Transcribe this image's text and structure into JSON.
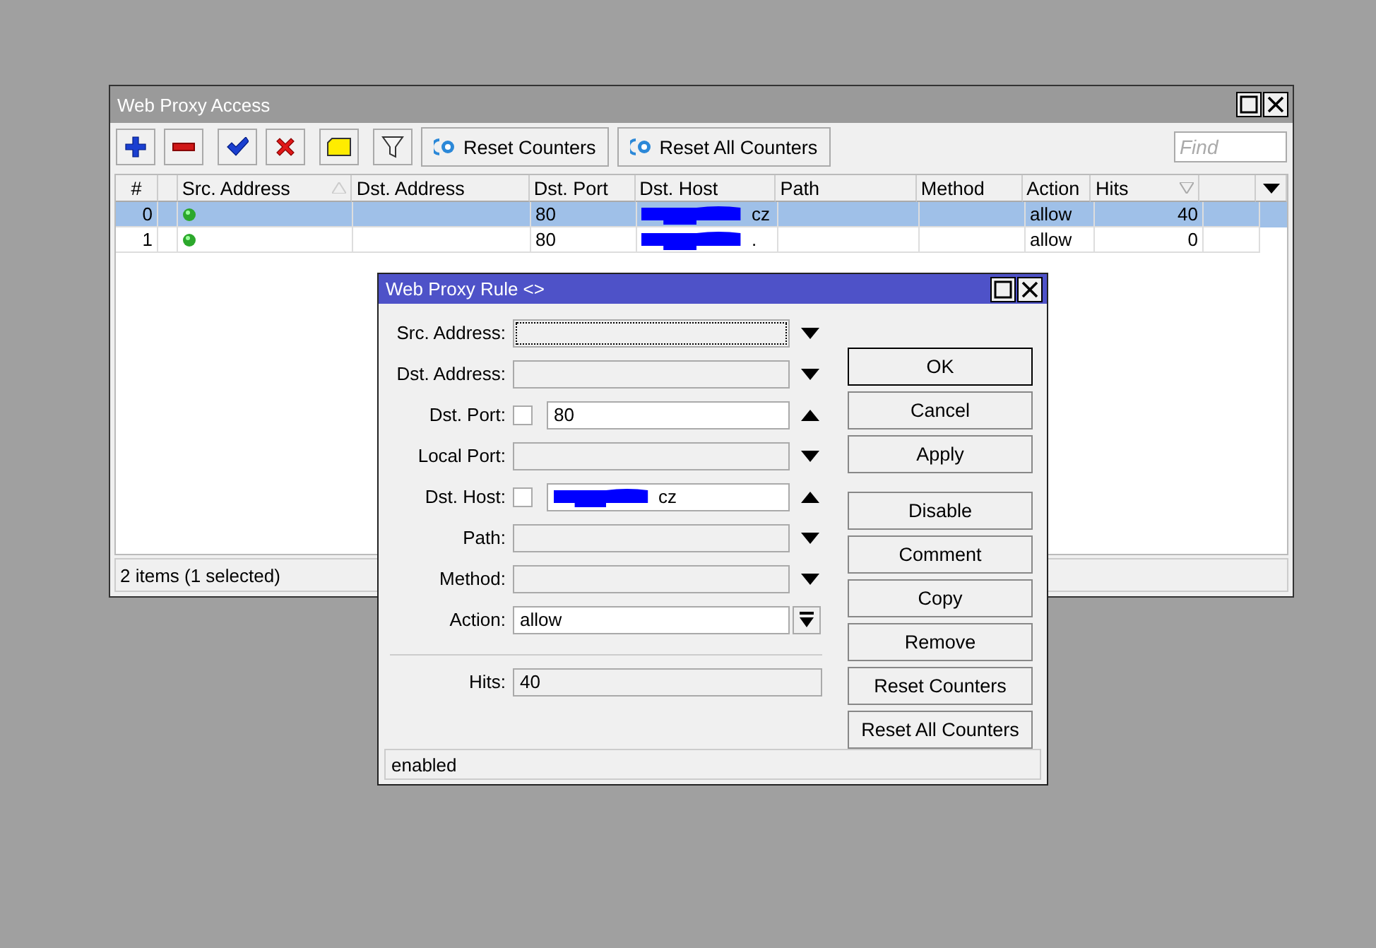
{
  "main_window": {
    "title": "Web Proxy Access",
    "toolbar": {
      "tools": [
        {
          "kind": "add"
        },
        {
          "kind": "remove"
        },
        {
          "kind": "enable"
        },
        {
          "kind": "disable"
        },
        {
          "kind": "comment"
        },
        {
          "kind": "filter"
        }
      ],
      "buttons": [
        "Reset Counters",
        "Reset All Counters"
      ],
      "search": {
        "placeholder": "Find"
      }
    },
    "table": {
      "columns": [
        {
          "label": "#",
          "sorted_ascending": false,
          "sorted_descending": false
        },
        {
          "sorted_ascending": false,
          "sorted_descending": false
        },
        {
          "label": "Src. Address",
          "sorted_ascending": true,
          "sorted_descending": false
        },
        {
          "label": "Dst. Address",
          "sorted_ascending": false,
          "sorted_descending": false
        },
        {
          "label": "Dst. Port",
          "sorted_ascending": false,
          "sorted_descending": false
        },
        {
          "label": "Dst. Host",
          "sorted_ascending": false,
          "sorted_descending": false
        },
        {
          "label": "Path",
          "sorted_ascending": false,
          "sorted_descending": false
        },
        {
          "label": "Method",
          "sorted_ascending": false,
          "sorted_descending": false
        },
        {
          "label": "Action",
          "sorted_ascending": false,
          "sorted_descending": false
        },
        {
          "label": "Hits",
          "sorted_ascending": false,
          "sorted_descending": true
        }
      ],
      "rows": [
        {
          "number": "0",
          "selected": true,
          "enabled": true,
          "dst_port": "80",
          "dst_host": "cz",
          "host_redacted": true,
          "action": "allow",
          "hits": "40"
        },
        {
          "number": "1",
          "selected": false,
          "enabled": true,
          "dst_port": "80",
          "dst_host": ".",
          "host_redacted": true,
          "action": "allow",
          "hits": "0"
        }
      ]
    },
    "status_bar": "2 items (1 selected)"
  },
  "dialog": {
    "title": "Web Proxy Rule <>",
    "fields": [
      {
        "label": "Src. Address:",
        "kind": "combo",
        "focused": true
      },
      {
        "label": "Dst. Address:",
        "kind": "combo",
        "focused": false
      },
      {
        "label": "Dst. Port:",
        "kind": "text",
        "value": "80",
        "checked": false
      },
      {
        "label": "Local Port:",
        "kind": "combo",
        "focused": false
      },
      {
        "label": "Dst. Host:",
        "kind": "text",
        "value": "cz",
        "checked": false,
        "redacted": true
      },
      {
        "label": "Path:",
        "kind": "combo",
        "focused": false
      },
      {
        "label": "Method:",
        "kind": "combo",
        "focused": false
      },
      {
        "label": "Action:",
        "kind": "select",
        "value": "allow"
      },
      {
        "label": "Hits:",
        "kind": "readonly",
        "value": "40"
      }
    ],
    "buttons": [
      {
        "label": "OK",
        "default": true
      },
      {
        "label": "Cancel",
        "default": false
      },
      {
        "label": "Apply",
        "default": false
      },
      {
        "label": "Disable",
        "default": false
      },
      {
        "label": "Comment",
        "default": false
      },
      {
        "label": "Copy",
        "default": false
      },
      {
        "label": "Remove",
        "default": false
      },
      {
        "label": "Reset Counters",
        "default": false
      },
      {
        "label": "Reset All Counters",
        "default": false
      }
    ],
    "status_bar": "enabled"
  }
}
